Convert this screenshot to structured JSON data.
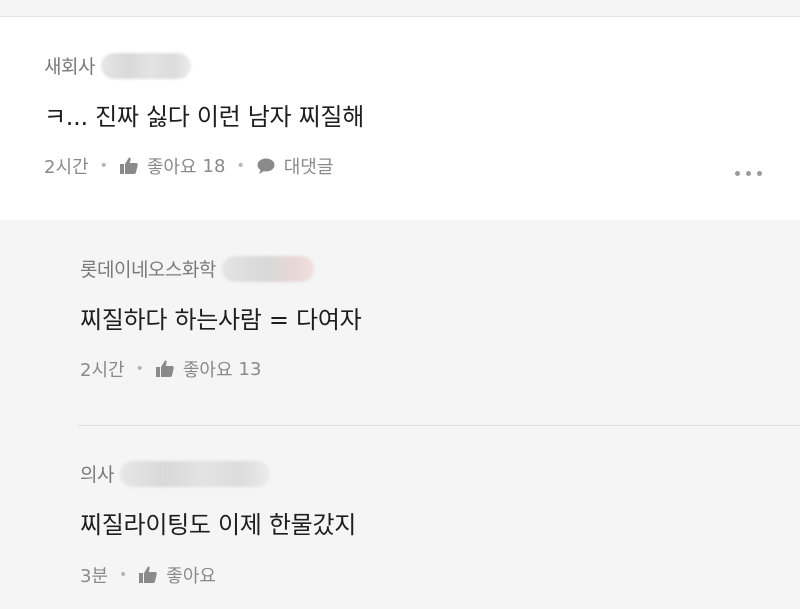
{
  "comments": [
    {
      "author": "새회사",
      "text": "ㅋ... 진짜 싫다 이런 남자 찌질해",
      "time": "2시간",
      "like_label": "좋아요",
      "like_count": "18",
      "reply_label": "대댓글"
    },
    {
      "author": "롯데이네오스화학",
      "text": "찌질하다 하는사람 = 다여자",
      "time": "2시간",
      "like_label": "좋아요",
      "like_count": "13"
    },
    {
      "author": "의사",
      "text": "찌질라이팅도 이제 한물갔지",
      "time": "3분",
      "like_label": "좋아요"
    }
  ],
  "colors": {
    "background": "#f5f5f5",
    "card": "#ffffff",
    "text": "#1e1e1e",
    "muted": "#8a8a8a"
  },
  "icons": [
    "thumbs-up-icon",
    "speech-bubble-icon",
    "more-options-icon"
  ]
}
